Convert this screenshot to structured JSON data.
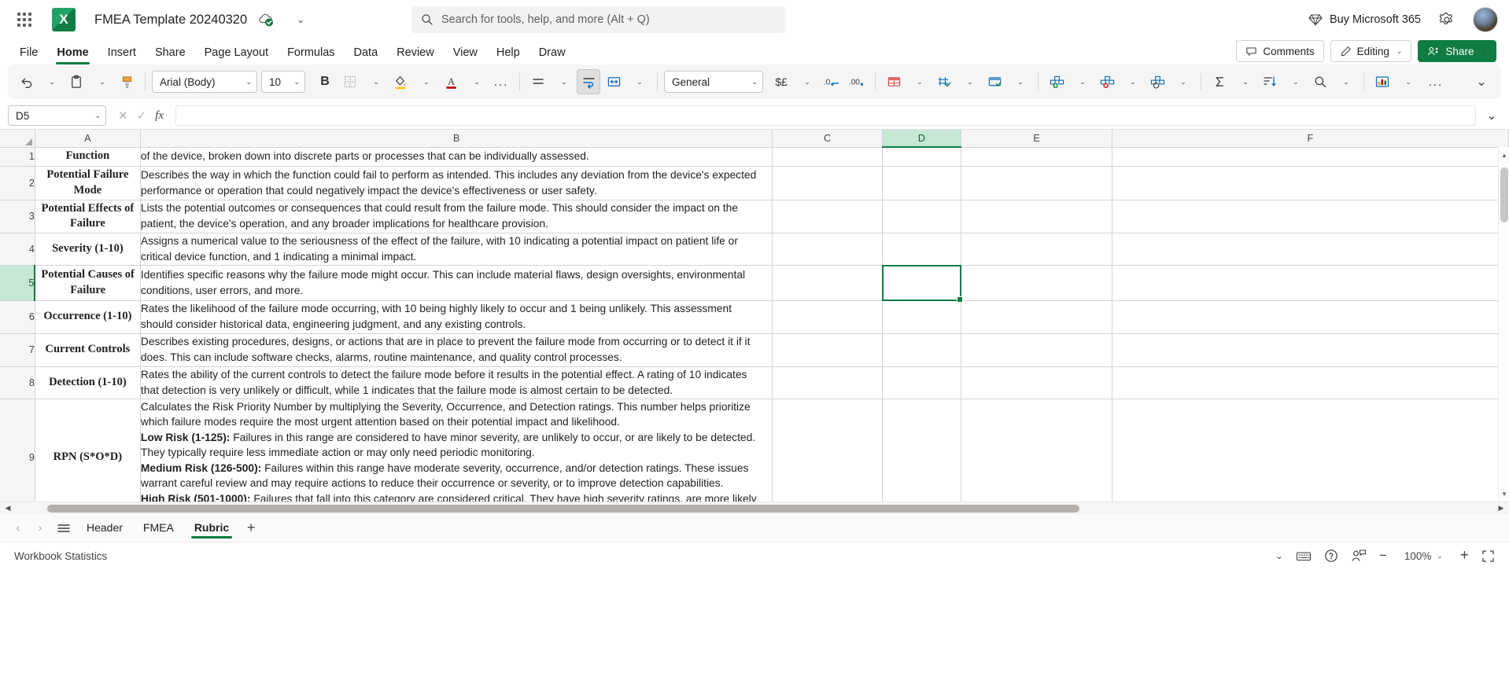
{
  "topbar": {
    "app_launcher": "app-launcher",
    "app_logo_letter": "X",
    "doc_title": "FMEA Template 20240320",
    "saved_status": "saved-to-cloud",
    "title_chevron": "⌄",
    "search_placeholder": "Search for tools, help, and more (Alt + Q)",
    "buy_365": "Buy Microsoft 365",
    "settings": "gear-icon",
    "account": "avatar"
  },
  "ribbon_tabs": {
    "items": [
      "File",
      "Home",
      "Insert",
      "Share",
      "Page Layout",
      "Formulas",
      "Data",
      "Review",
      "View",
      "Help",
      "Draw"
    ],
    "active": "Home",
    "comments": "Comments",
    "editing": "Editing",
    "share": "Share",
    "chevron": "⌄"
  },
  "ribbon": {
    "undo": "undo-icon",
    "paste": "paste-icon",
    "format_painter": "format-painter-icon",
    "font_name": "Arial (Body)",
    "font_size": "10",
    "bold": "B",
    "borders": "borders-icon",
    "fill_color": "fill-color-icon",
    "font_color": "A",
    "more_font": "...",
    "align": "align-icon",
    "wrap_text": "wrap-text-icon",
    "merge": "merge-cells-icon",
    "number_format": "General",
    "currency": "$£",
    "decrease_decimal": ".0",
    "increase_decimal": ".00",
    "cond_format": "conditional-formatting-icon",
    "format_table": "format-as-table-icon",
    "cell_styles": "cell-styles-icon",
    "insert_cells": "insert-cells-icon",
    "delete_cells": "delete-cells-icon",
    "format_cells": "format-cells-icon",
    "autosum": "autosum-icon",
    "sort_filter": "sort-filter-icon",
    "find": "find-icon",
    "ideas": "analyze-data-icon",
    "more": "...",
    "collapse": "⌄"
  },
  "formula_bar": {
    "name_box": "D5",
    "name_chevron": "⌄",
    "cancel": "✕",
    "enter": "✓",
    "fx": "fx",
    "formula_value": "",
    "expand": "⌄"
  },
  "grid": {
    "columns": [
      "A",
      "B",
      "C",
      "D",
      "E",
      "F"
    ],
    "selected_column": "D",
    "selected_row": "5",
    "active_cell": "D5",
    "rows": [
      {
        "num": "1",
        "a": "Function",
        "b_lines": [
          "of the device, broken down into discrete parts or processes that can be individually assessed."
        ]
      },
      {
        "num": "2",
        "a": "Potential Failure Mode",
        "b_lines": [
          "Describes the way in which the function could fail to perform as intended. This includes any deviation from the device's expected",
          "performance or operation that could negatively impact the device's effectiveness or user safety."
        ]
      },
      {
        "num": "3",
        "a": "Potential Effects of Failure",
        "b_lines": [
          "Lists the potential outcomes or consequences that could result from the failure mode. This should consider the impact on the",
          "patient, the device's operation, and any broader implications for healthcare provision."
        ]
      },
      {
        "num": "4",
        "a": "Severity (1-10)",
        "b_lines": [
          "Assigns a numerical value to the seriousness of the effect of the failure, with 10 indicating a potential impact on patient life or",
          "critical device function, and 1 indicating a minimal impact."
        ]
      },
      {
        "num": "5",
        "a": "Potential Causes of Failure",
        "b_lines": [
          "Identifies specific reasons why the failure mode might occur. This can include material flaws, design oversights, environmental",
          "conditions, user errors, and more."
        ]
      },
      {
        "num": "6",
        "a": "Occurrence (1-10)",
        "b_lines": [
          "Rates the likelihood of the failure mode occurring, with 10 being highly likely to occur and 1 being unlikely. This assessment",
          "should consider historical data, engineering judgment, and any existing controls."
        ]
      },
      {
        "num": "7",
        "a": "Current Controls",
        "b_lines": [
          "Describes existing procedures, designs, or actions that are in place to prevent the failure mode from occurring or to detect it if it",
          "does. This can include software checks, alarms, routine maintenance, and quality control processes."
        ]
      },
      {
        "num": "8",
        "a": "Detection (1-10)",
        "b_lines": [
          "Rates the ability of the current controls to detect the failure mode before it results in the potential effect. A rating of 10 indicates",
          "that detection is very unlikely or difficult, while 1 indicates that the failure mode is almost certain to be detected."
        ]
      }
    ],
    "row9": {
      "num": "9",
      "a": "RPN (S*O*D)",
      "paragraphs": [
        {
          "bold": "",
          "text": "Calculates the Risk Priority Number by multiplying the Severity, Occurrence, and Detection ratings. This number helps prioritize"
        },
        {
          "bold": "",
          "text": "which failure modes require the most urgent attention based on their potential impact and likelihood."
        },
        {
          "bold": "Low Risk (1-125):",
          "text": " Failures in this range are considered to have minor severity, are unlikely to occur, or are likely to be detected."
        },
        {
          "bold": "",
          "text": "They typically require less immediate action or may only need periodic monitoring."
        },
        {
          "bold": "Medium Risk (126-500):",
          "text": " Failures within this range have moderate severity, occurrence, and/or detection ratings. These issues"
        },
        {
          "bold": "",
          "text": "warrant careful review and may require actions to reduce their occurrence or severity, or to improve detection capabilities."
        },
        {
          "bold": "High Risk (501-1000):",
          "text": " Failures that fall into this category are considered critical. They have high severity ratings, are more likely"
        }
      ]
    }
  },
  "sheet_tabs": {
    "prev": "‹",
    "next": "›",
    "all_sheets": "all-sheets-menu",
    "items": [
      "Header",
      "FMEA",
      "Rubric"
    ],
    "active": "Rubric",
    "add": "+"
  },
  "status_bar": {
    "workbook_statistics": "Workbook Statistics",
    "chevron": "⌄",
    "keyboard": "keyboard-icon",
    "help": "help-icon",
    "feedback": "feedback-icon",
    "zoom_out": "−",
    "zoom_level": "100%",
    "zoom_in": "+",
    "fullscreen": "fullscreen-icon"
  },
  "colors": {
    "excel_green": "#107c41",
    "accent_light": "#c6e7d4",
    "grid_line": "#d4d4d4"
  }
}
